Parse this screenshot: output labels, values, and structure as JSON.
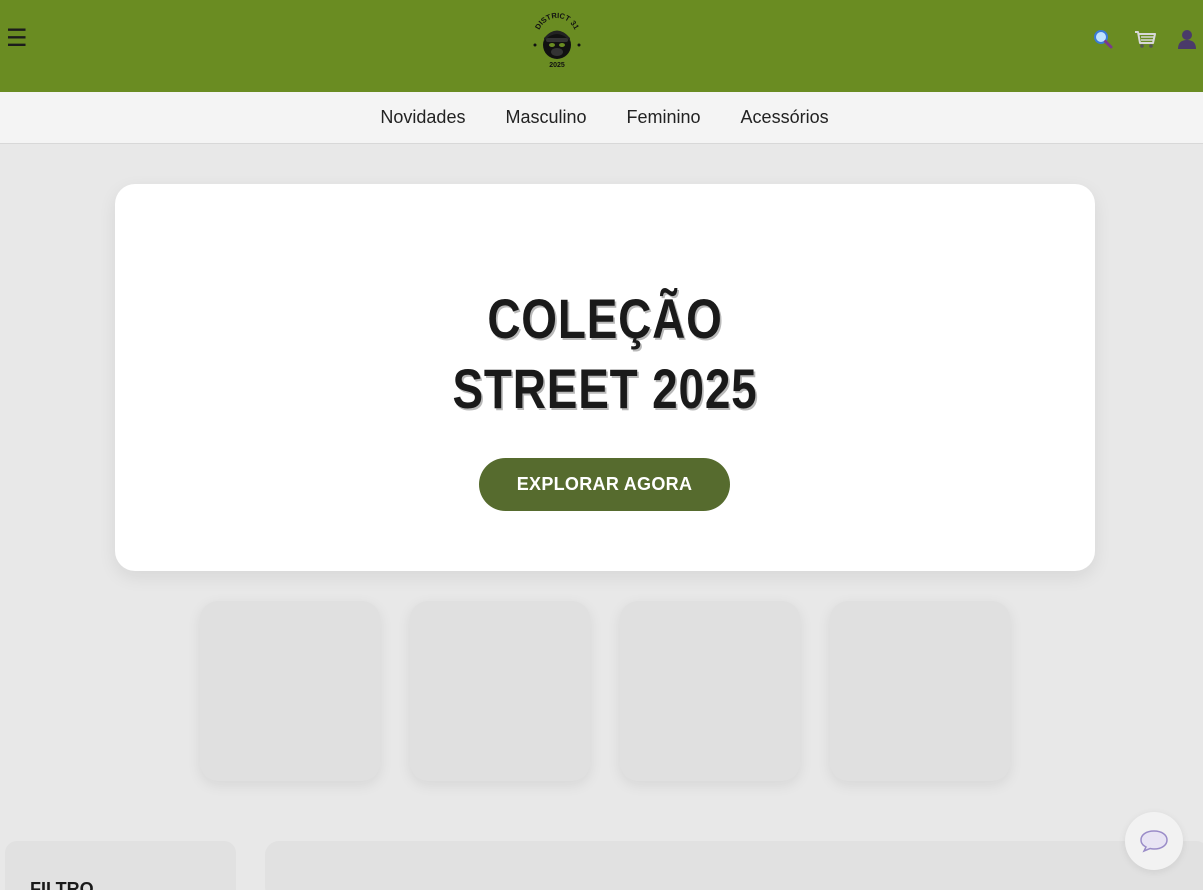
{
  "header": {
    "menu_glyph": "☰",
    "logo": {
      "text_top": "DISTRICT 31",
      "text_bottom": "2025"
    },
    "icons": [
      "search-icon",
      "cart-icon",
      "user-icon"
    ]
  },
  "nav": {
    "items": [
      {
        "label": "Novidades"
      },
      {
        "label": "Masculino"
      },
      {
        "label": "Feminino"
      },
      {
        "label": "Acessórios"
      }
    ]
  },
  "hero": {
    "title_line1": "COLEÇÃO",
    "title_line2": "STREET 2025",
    "cta_label": "EXPLORAR AGORA"
  },
  "filter": {
    "title": "FILTRO"
  },
  "colors": {
    "header_bg": "#6a8c22",
    "nav_bg": "#f4f4f4",
    "page_bg": "#e8e8e8",
    "cta_bg": "#566b2e"
  }
}
